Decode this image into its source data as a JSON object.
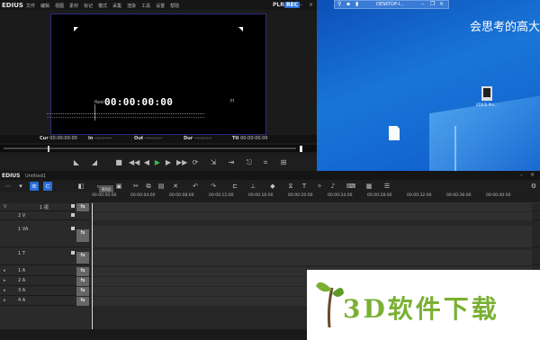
{
  "player": {
    "app_name": "EDIUS",
    "menu": [
      "文件",
      "编辑",
      "视图",
      "素材",
      "标记",
      "模式",
      "采集",
      "渲染",
      "工具",
      "设置",
      "帮助"
    ],
    "mode_plr": "PLR",
    "mode_rec": "REC",
    "reel": "Reel",
    "timecode": "00:00:00:00",
    "fi": "FI",
    "cur_label": "Cur",
    "cur_value": "00:00:00:00",
    "in_label": "In",
    "in_value": "--:--:--:--",
    "out_label": "Out",
    "out_value": "--:--:--:--",
    "dur_label": "Dur",
    "dur_value": "--:--:--:--",
    "ttl_label": "Ttl",
    "ttl_value": "00:00:00:00"
  },
  "desktop": {
    "rdp_title": "DESKTOP-I...",
    "headline": "会思考的高大",
    "icon_label": "EDIUS Pro..."
  },
  "timeline": {
    "app_name": "EDIUS",
    "project": "Untitled1",
    "sequence_tab": "序列1",
    "ruler": [
      "00:00:00:00",
      "00:00:04:00",
      "00:00:08:00",
      "00:00:12:00",
      "00:00:16:00",
      "00:00:20:00",
      "00:00:24:00",
      "00:00:28:00",
      "00:00:32:00",
      "00:00:36:00",
      "00:00:40:00"
    ],
    "tracks": [
      {
        "label": "1 视",
        "type": "V"
      },
      {
        "label": "2 V",
        "type": "V"
      },
      {
        "label": "1 VA",
        "type": "VA"
      },
      {
        "label": "1 T",
        "type": "T"
      },
      {
        "label": "1 A",
        "type": "A"
      },
      {
        "label": "2 A",
        "type": "A"
      },
      {
        "label": "3 A",
        "type": "A"
      },
      {
        "label": "4 A",
        "type": "A"
      }
    ]
  },
  "watermark": {
    "text": "3D软件下载"
  }
}
